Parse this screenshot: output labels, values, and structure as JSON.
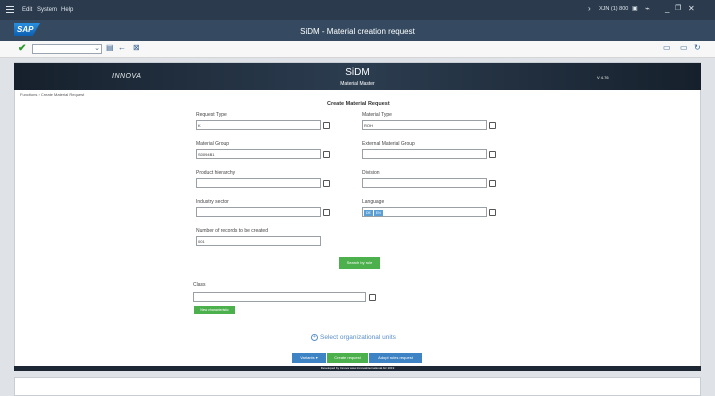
{
  "menubar": {
    "items": [
      "Edit",
      "System",
      "Help"
    ],
    "system_id": "XJN (1) 800"
  },
  "titlebar": {
    "logo_text": "SAP",
    "title": "SiDM - Material creation request"
  },
  "banner": {
    "brand": "INNOVA",
    "title": "SiDM",
    "subtitle": "Material Master",
    "version": "V 4.76"
  },
  "breadcrumb": "Functions › Create Material Request",
  "form": {
    "title": "Create Material Request",
    "request_type": {
      "label": "Request Type",
      "value": "K"
    },
    "material_type": {
      "label": "Material Type",
      "value": "ROH"
    },
    "material_group": {
      "label": "Material Group",
      "value": "S0094B1"
    },
    "external_material_group": {
      "label": "External Material Group",
      "value": ""
    },
    "product_hierarchy": {
      "label": "Product hierarchy",
      "value": ""
    },
    "division": {
      "label": "Division",
      "value": ""
    },
    "industry_sector": {
      "label": "Industry sector",
      "value": ""
    },
    "language": {
      "label": "Language",
      "tags": [
        "DE",
        "EN"
      ]
    },
    "num_records": {
      "label": "Number of records to be created",
      "value": "001"
    },
    "search_by_rule": "Search by rule",
    "class": {
      "label": "Class",
      "value": ""
    },
    "new_characteristic": "New characteristic",
    "select_org_units": "Select organizational units"
  },
  "actions": {
    "variants": "Variants ▾",
    "create_request": "Create request",
    "adopt_rules_request": "Adopt rules request"
  },
  "footer": "Developed by Innova www.innovainternational.biz 2019",
  "colors": {
    "menubar": "#2b3a4d",
    "titlebar": "#354a61",
    "green_button": "#4cb04c",
    "blue_button": "#3e84c4",
    "link": "#5b8fc9"
  }
}
